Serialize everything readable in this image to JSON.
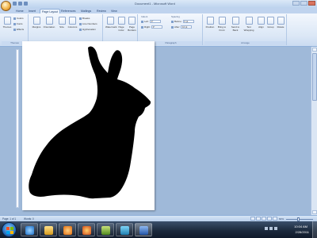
{
  "window": {
    "title": "Document1 - Microsoft Word"
  },
  "tabs": [
    {
      "label": "Home"
    },
    {
      "label": "Insert"
    },
    {
      "label": "Page Layout"
    },
    {
      "label": "References"
    },
    {
      "label": "Mailings"
    },
    {
      "label": "Review"
    },
    {
      "label": "View"
    }
  ],
  "ribbon": {
    "themes": {
      "big": "Themes",
      "colors": "Colors",
      "fonts": "Fonts",
      "effects": "Effects",
      "group": "Themes"
    },
    "page_setup": {
      "margins": "Margins",
      "orientation": "Orientation",
      "size": "Size",
      "columns": "Columns",
      "breaks": "Breaks",
      "line_numbers": "Line Numbers",
      "hyphenation": "Hyphenation",
      "group": "Page Setup"
    },
    "page_background": {
      "watermark": "Watermark",
      "page_color": "Page Color",
      "page_borders": "Page Borders",
      "group": "Page Background"
    },
    "paragraph": {
      "indent": "Indent",
      "left_label": "Left:",
      "left_value": "0\"",
      "right_label": "Right:",
      "right_value": "0\"",
      "spacing": "Spacing",
      "before_label": "Before:",
      "before_value": "0 pt",
      "after_label": "After:",
      "after_value": "10 pt",
      "group": "Paragraph"
    },
    "arrange": {
      "position": "Position",
      "bring_to_front": "Bring to Front",
      "send_to_back": "Send to Back",
      "text_wrapping": "Text Wrapping",
      "align": "Align",
      "group_btn": "Group",
      "rotate": "Rotate",
      "group": "Arrange"
    }
  },
  "status": {
    "page": "Page: 1 of 1",
    "words": "Words: 0",
    "zoom": "60%",
    "zoom_level": 0.45
  },
  "taskbar": {
    "time": "10:04 AM",
    "date": "2/28/2011"
  },
  "image": {
    "subject": "rabbit-silhouette",
    "fill": "#000000"
  },
  "colors": {
    "accent": "#2a72c2",
    "ribbon": "#dbe7f6",
    "workspace": "#9fb9d9"
  }
}
